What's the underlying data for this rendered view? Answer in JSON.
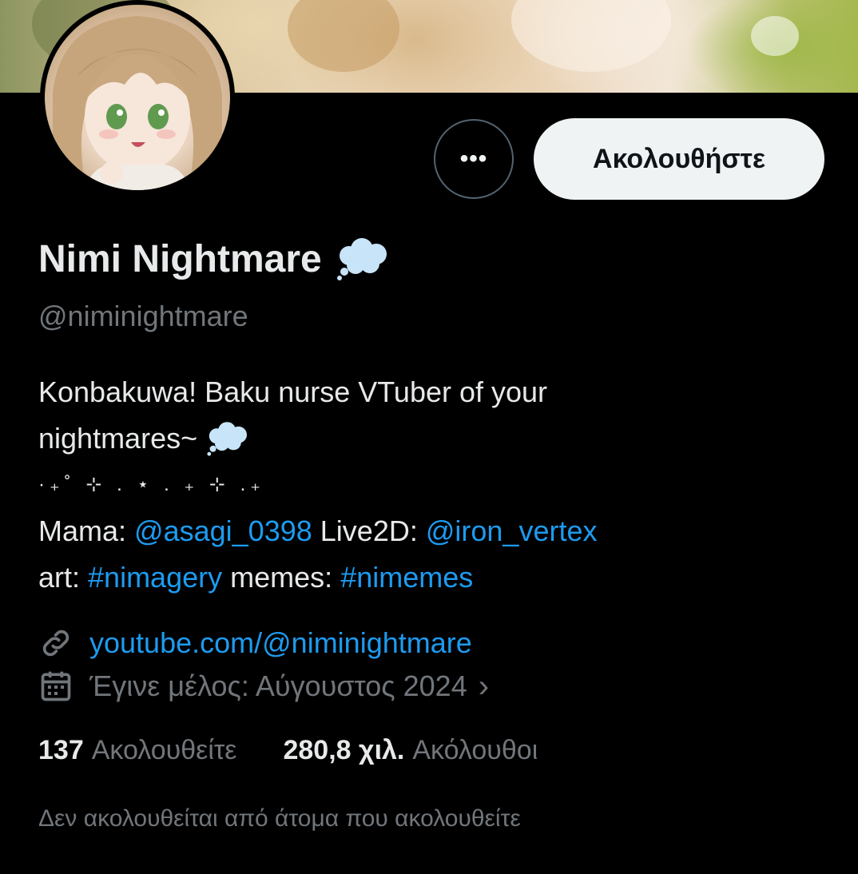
{
  "profile": {
    "display_name": "Nimi Nightmare",
    "handle": "@niminightmare",
    "name_emoji_icon": "thought-balloon-icon"
  },
  "actions": {
    "more_label": "•••",
    "follow_label": "Ακολουθήστε"
  },
  "bio": {
    "line1": "Konbakuwa! Baku nurse VTuber of your",
    "line2": "nightmares~",
    "sparkles": "·₊˚ ⊹ . ⋆ . ₊ ⊹ .₊",
    "mama_label": "Mama:",
    "mama_link": "@asagi_0398",
    "live2d_label": "Live2D:",
    "live2d_link": "@iron_vertex",
    "art_label": "art:",
    "art_tag": "#nimagery",
    "memes_label": "memes:",
    "memes_tag": "#nimemes"
  },
  "meta": {
    "website": "youtube.com/@niminightmare",
    "website_icon": "link-icon",
    "joined": "Έγινε μέλος: Αύγουστος 2024",
    "joined_icon": "calendar-icon",
    "chevron": "›"
  },
  "stats": {
    "following_count": "137",
    "following_label": "Ακολουθείτε",
    "followers_count": "280,8 χιλ.",
    "followers_label": "Ακόλουθοι"
  },
  "social_context": "Δεν ακολουθείται από άτομα που ακολουθείτε",
  "colors": {
    "background": "#000000",
    "text": "#e7e9ea",
    "muted": "#71767b",
    "link": "#1d9bf0",
    "follow_button_bg": "#eff3f4"
  }
}
